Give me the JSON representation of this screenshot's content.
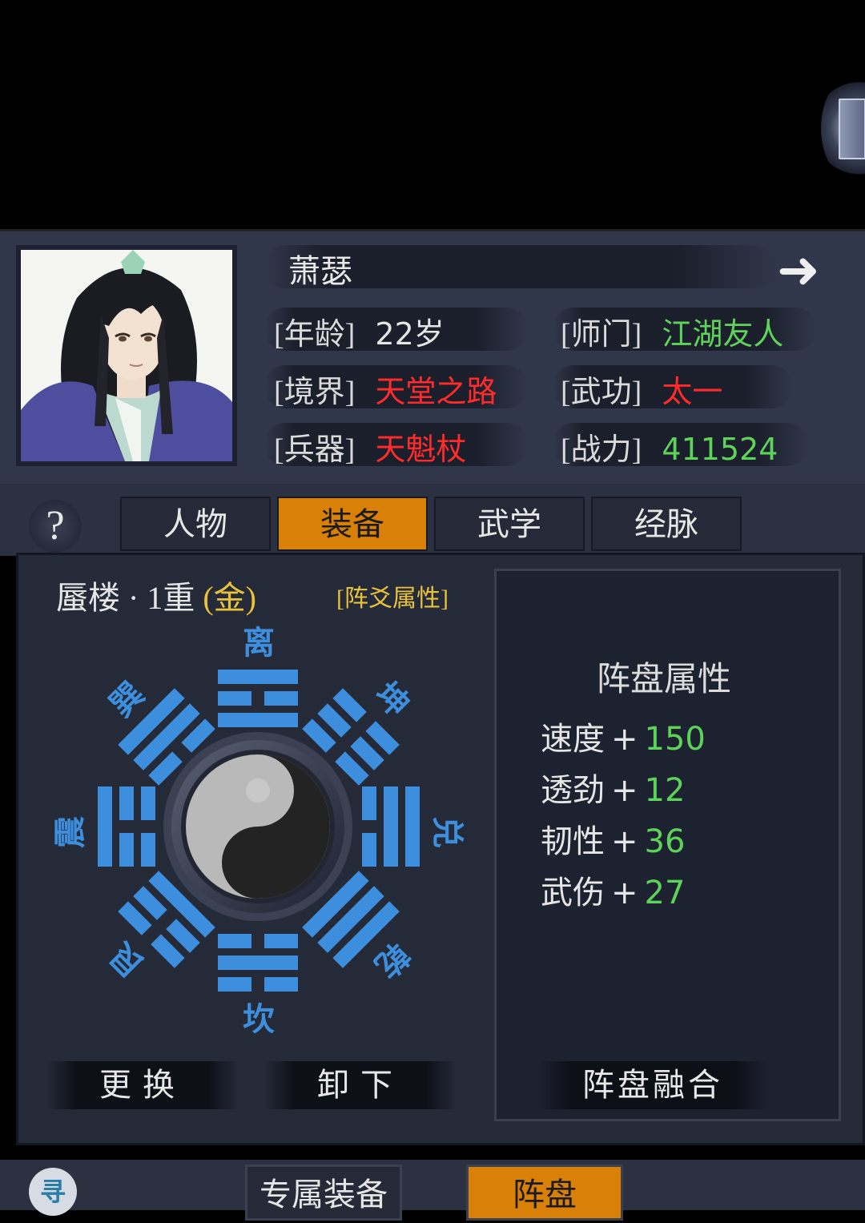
{
  "character": {
    "name": "萧瑟",
    "fields": [
      {
        "label": "[年龄]",
        "value": "22岁",
        "color": "#e6e6e6"
      },
      {
        "label": "[师门]",
        "value": "江湖友人",
        "color": "#5ed35a"
      },
      {
        "label": "[境界]",
        "value": "天堂之路",
        "color": "#ff2b2b"
      },
      {
        "label": "[武功]",
        "value": "太一",
        "color": "#ff2b2b"
      },
      {
        "label": "[兵器]",
        "value": "天魁杖",
        "color": "#ff2b2b"
      },
      {
        "label": "[战力]",
        "value": "411524",
        "color": "#5ed35a"
      }
    ]
  },
  "tabs": [
    "人物",
    "装备",
    "武学",
    "经脉"
  ],
  "active_tab": "装备",
  "help_label": "?",
  "formation": {
    "name": "蜃楼 · 1重",
    "grade": "(金)",
    "attr_link": "[阵爻属性]",
    "trigrams": {
      "li": "离",
      "kun": "坤",
      "dui": "兑",
      "qian": "乾",
      "kan": "坎",
      "gen": "艮",
      "zhen": "震",
      "xun": "巽"
    }
  },
  "panel": {
    "title": "阵盘属性",
    "stats": [
      {
        "name": "速度",
        "plus": "+",
        "value": "150"
      },
      {
        "name": "透劲",
        "plus": "+",
        "value": "12"
      },
      {
        "name": "韧性",
        "plus": "+",
        "value": "36"
      },
      {
        "name": "武伤",
        "plus": "+",
        "value": "27"
      }
    ]
  },
  "actions": {
    "replace": "更换",
    "unload": "卸下",
    "fuse": "阵盘融合"
  },
  "bottom_tabs": [
    "专属装备",
    "阵盘"
  ],
  "bottom_active": "阵盘",
  "search_icon_label": "寻",
  "colors": {
    "accent": "#d98008",
    "trigram": "#3d8fdd",
    "gold": "#e9c23c",
    "green": "#5ed35a",
    "red": "#ff2b2b"
  }
}
